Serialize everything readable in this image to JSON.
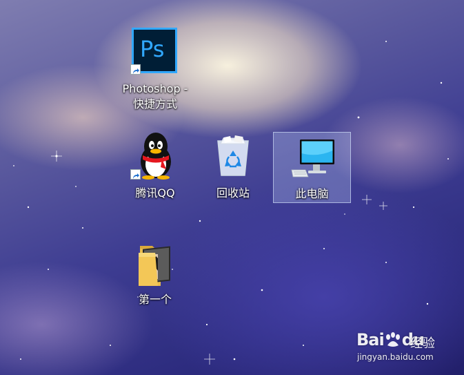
{
  "desktop": {
    "icons": [
      {
        "label_line1": "Photoshop -",
        "label_line2": "快捷方式",
        "icon": "photoshop-icon",
        "badge_text": "Ps",
        "shortcut": true
      },
      {
        "label": "腾讯QQ",
        "icon": "qq-penguin-icon",
        "shortcut": true
      },
      {
        "label": "回收站",
        "icon": "recycle-bin-icon",
        "shortcut": false
      },
      {
        "label": "此电脑",
        "icon": "computer-icon",
        "shortcut": false,
        "selected": true
      },
      {
        "label": "第一个",
        "icon": "folder-icon",
        "shortcut": false
      }
    ]
  },
  "watermark": {
    "brand": "Bai",
    "brand_tail": "du",
    "product": "经验",
    "url": "jingyan.baidu.com"
  },
  "colors": {
    "photoshop_bg": "#001e36",
    "photoshop_accent": "#31a8ff",
    "selection": "#c8dcff"
  }
}
